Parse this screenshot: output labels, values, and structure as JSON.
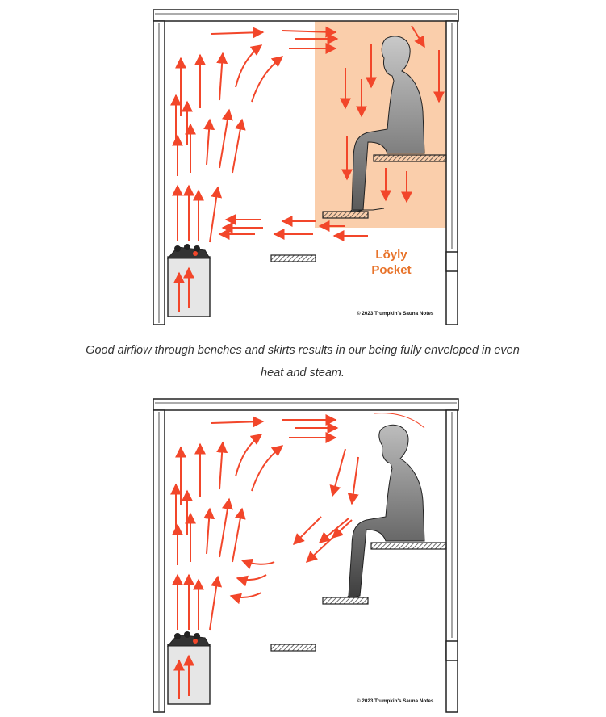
{
  "diagrams": [
    {
      "id": "enveloped-heat",
      "copyright": "© 2023 Trumpkin's Sauna Notes",
      "pocket_label_line1": "Löyly",
      "pocket_label_line2": "Pocket",
      "pocket_color": "#f9c9a2"
    },
    {
      "id": "poor-airflow",
      "copyright": "© 2023 Trumpkin's Sauna Notes"
    }
  ],
  "caption_line1": "Good airflow through benches and skirts results in our being fully enveloped in even",
  "caption_line2": "heat and steam.",
  "colors": {
    "arrow": "#f2462a",
    "wall": "#222222",
    "person_top": "#bfbfbf",
    "person_bottom": "#4a4a4a"
  },
  "icons": [
    "sauna-stove-icon",
    "seated-person-icon",
    "airflow-arrow-icon",
    "bench-icon"
  ]
}
